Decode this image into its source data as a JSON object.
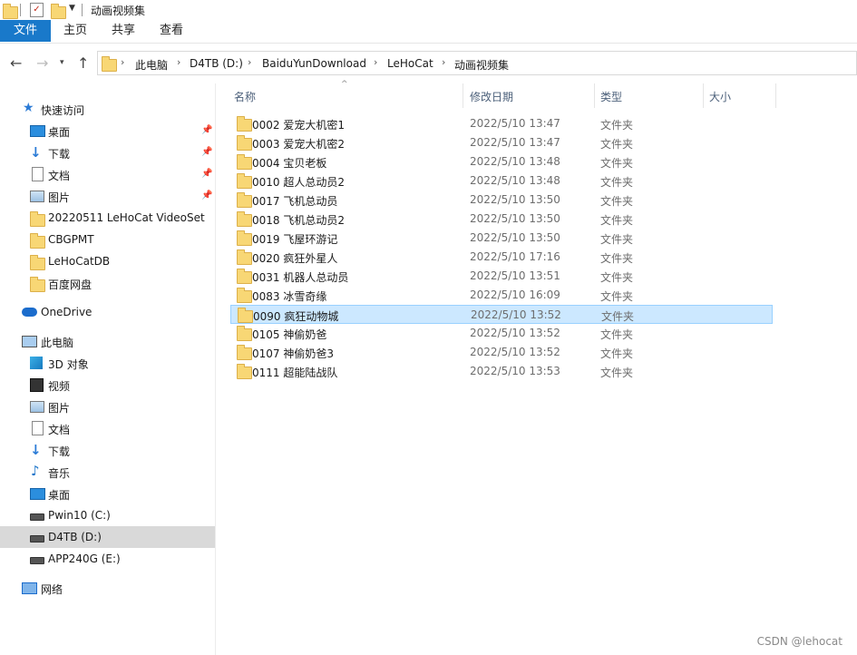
{
  "window": {
    "title": "动画视频集"
  },
  "ribbon": {
    "tabs": [
      "文件",
      "主页",
      "共享",
      "查看"
    ]
  },
  "address": {
    "crumbs": [
      "此电脑",
      "D4TB (D:)",
      "BaiduYunDownload",
      "LeHoCat",
      "动画视频集"
    ]
  },
  "sidebar": {
    "quick_access": "快速访问",
    "quick_items": [
      "桌面",
      "下载",
      "文档",
      "图片",
      "20220511 LeHoCat VideoSet",
      "CBGPMT",
      "LeHoCatDB",
      "百度网盘"
    ],
    "onedrive": "OneDrive",
    "this_pc": "此电脑",
    "pc_items": [
      "3D 对象",
      "视频",
      "图片",
      "文档",
      "下载",
      "音乐",
      "桌面",
      "Pwin10 (C:)",
      "D4TB (D:)",
      "APP240G (E:)"
    ],
    "network": "网络"
  },
  "columns": {
    "name": "名称",
    "date": "修改日期",
    "type": "类型",
    "size": "大小"
  },
  "rows": [
    {
      "name": "0002 爱宠大机密1",
      "date": "2022/5/10 13:47",
      "type": "文件夹"
    },
    {
      "name": "0003 爱宠大机密2",
      "date": "2022/5/10 13:47",
      "type": "文件夹"
    },
    {
      "name": "0004 宝贝老板",
      "date": "2022/5/10 13:48",
      "type": "文件夹"
    },
    {
      "name": "0010 超人总动员2",
      "date": "2022/5/10 13:48",
      "type": "文件夹"
    },
    {
      "name": "0017 飞机总动员",
      "date": "2022/5/10 13:50",
      "type": "文件夹"
    },
    {
      "name": "0018 飞机总动员2",
      "date": "2022/5/10 13:50",
      "type": "文件夹"
    },
    {
      "name": "0019 飞屋环游记",
      "date": "2022/5/10 13:50",
      "type": "文件夹"
    },
    {
      "name": "0020 疯狂外星人",
      "date": "2022/5/10 17:16",
      "type": "文件夹"
    },
    {
      "name": "0031 机器人总动员",
      "date": "2022/5/10 13:51",
      "type": "文件夹"
    },
    {
      "name": "0083 冰雪奇缘",
      "date": "2022/5/10 16:09",
      "type": "文件夹"
    },
    {
      "name": "0090 疯狂动物城",
      "date": "2022/5/10 13:52",
      "type": "文件夹"
    },
    {
      "name": "0105 神偷奶爸",
      "date": "2022/5/10 13:52",
      "type": "文件夹"
    },
    {
      "name": "0107 神偷奶爸3",
      "date": "2022/5/10 13:52",
      "type": "文件夹"
    },
    {
      "name": "0111 超能陆战队",
      "date": "2022/5/10 13:53",
      "type": "文件夹"
    }
  ],
  "selected_row": "0090 疯狂动物城",
  "watermark": "CSDN @lehocat"
}
